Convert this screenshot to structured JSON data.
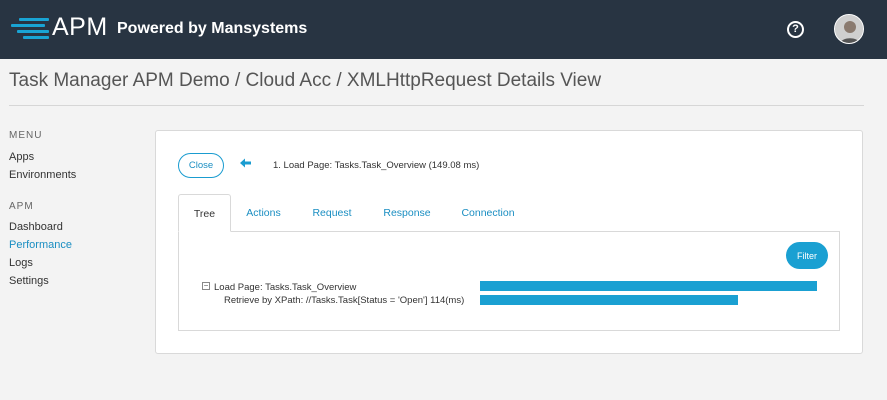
{
  "header": {
    "logo_text": "APM",
    "tagline": "Powered by Mansystems",
    "help_label": "?"
  },
  "page": {
    "title": "Task Manager APM Demo / Cloud Acc / XMLHttpRequest Details View"
  },
  "sidebar": {
    "sections": [
      {
        "label": "MENU",
        "items": [
          {
            "label": "Apps"
          },
          {
            "label": "Environments"
          }
        ]
      },
      {
        "label": "APM",
        "items": [
          {
            "label": "Dashboard"
          },
          {
            "label": "Performance",
            "active": true
          },
          {
            "label": "Logs"
          },
          {
            "label": "Settings"
          }
        ]
      }
    ]
  },
  "details": {
    "close_label": "Close",
    "back_icon": "arrow-left-icon",
    "breadcrumb": "1. Load Page: Tasks.Task_Overview (149.08 ms)",
    "tabs": [
      {
        "label": "Tree",
        "active": true
      },
      {
        "label": "Actions"
      },
      {
        "label": "Request"
      },
      {
        "label": "Response"
      },
      {
        "label": "Connection"
      }
    ],
    "filter_label": "Filter",
    "tree": [
      {
        "label": "Load Page: Tasks.Task_Overview",
        "expanded": true,
        "duration_ratio": 1.0
      },
      {
        "label": "Retrieve by XPath: //Tasks.Task[Status = 'Open'] 114(ms)",
        "duration_ratio": 0.765
      }
    ]
  },
  "colors": {
    "header_bg": "#283442",
    "accent": "#1aa0d2",
    "active_link": "#1a8ec2"
  }
}
